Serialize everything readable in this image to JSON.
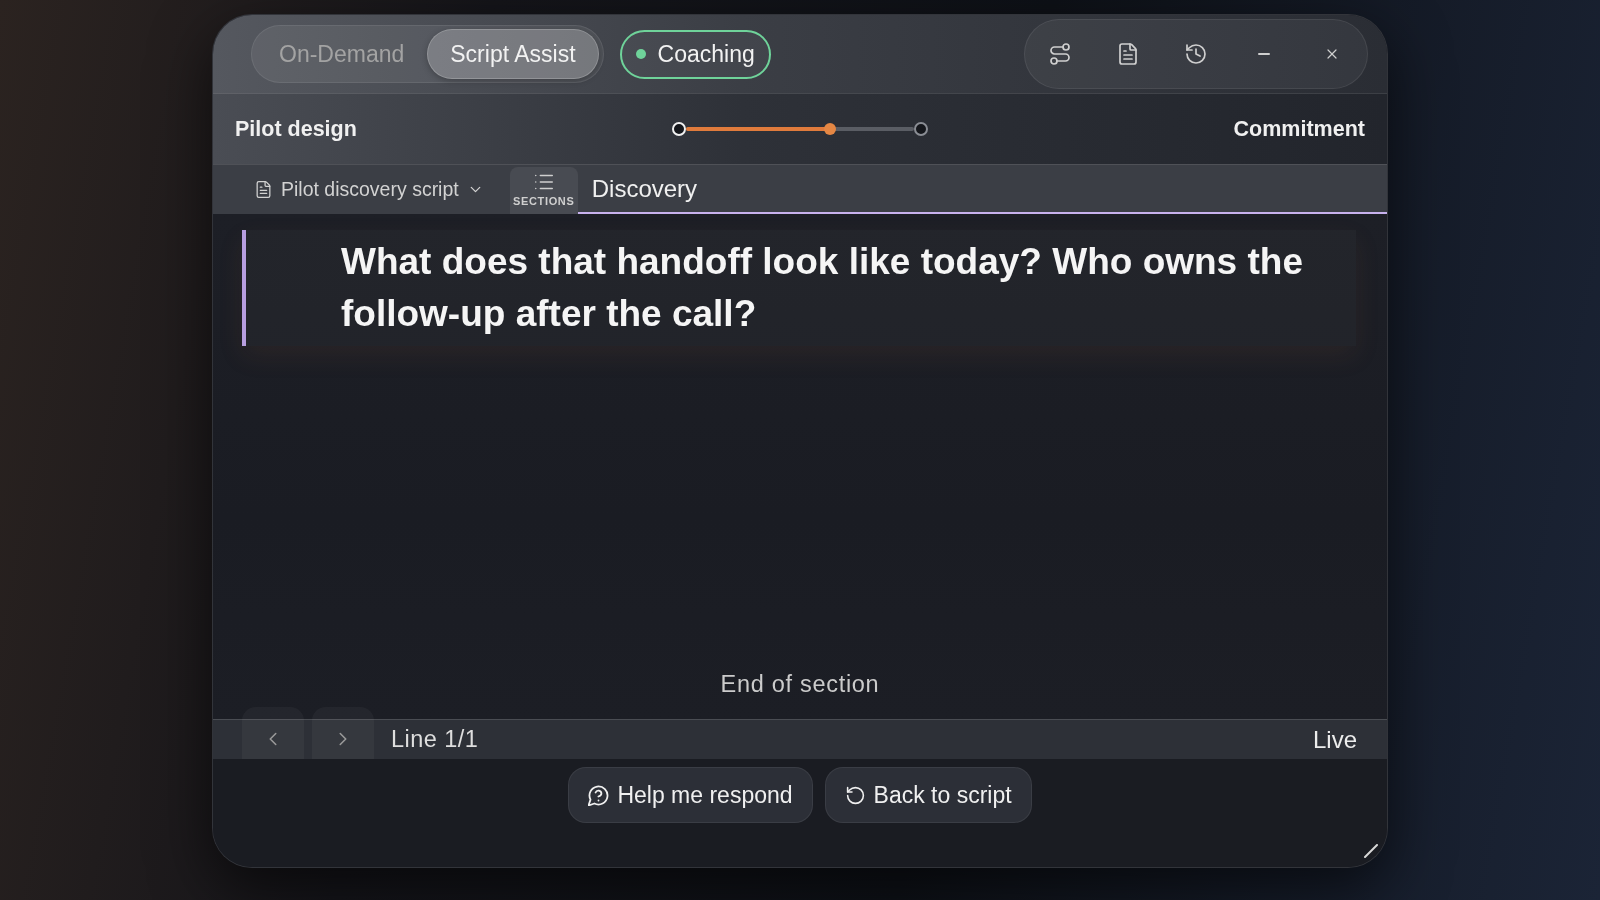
{
  "modes": [
    {
      "label": "On-Demand",
      "selected": false
    },
    {
      "label": "Script Assist",
      "selected": true
    }
  ],
  "coaching": {
    "label": "Coaching",
    "on": true
  },
  "progress": {
    "start_label": "Pilot design",
    "level": 0.63,
    "end_label": "Commitment"
  },
  "script_bar": {
    "script": "Pilot discovery script",
    "sections_button": "SECTIONS",
    "section": "Discovery"
  },
  "question": "What does that handoff look like today? Who owns the follow-up after the call?",
  "end_note": "End of section",
  "status_bar": {
    "line": "Line 1/1",
    "status": "Live"
  },
  "actions": [
    {
      "kind": "help",
      "label": "Help me respond"
    },
    {
      "kind": "back",
      "label": "Back to script"
    }
  ]
}
